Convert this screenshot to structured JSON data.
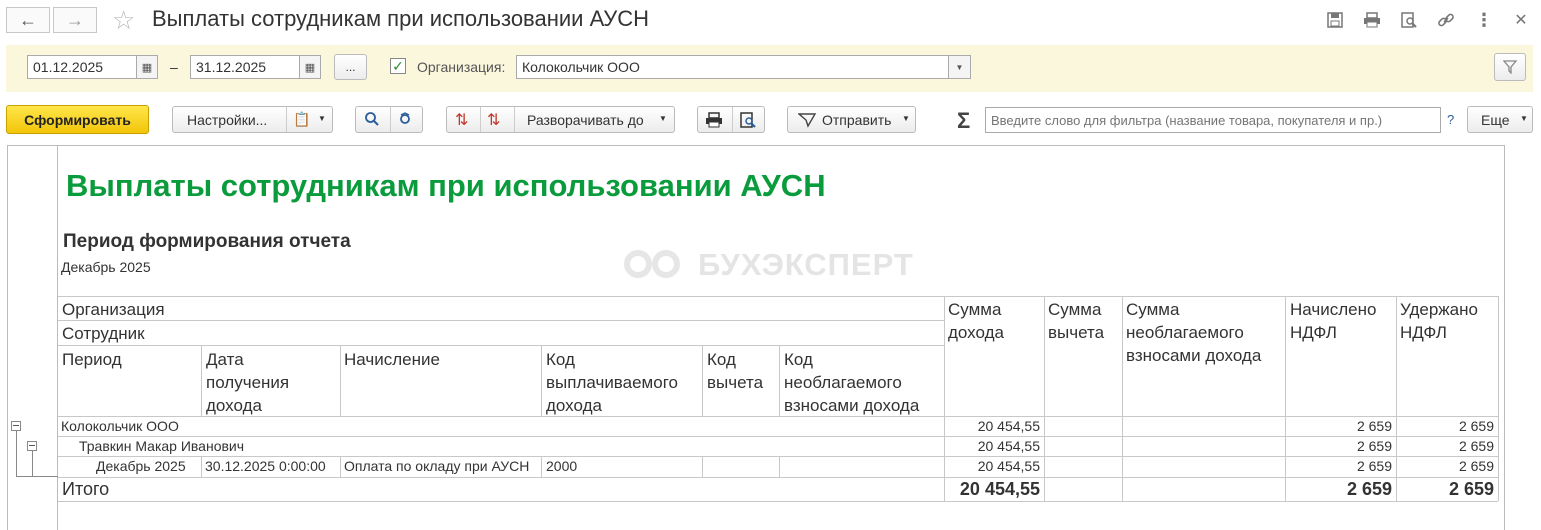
{
  "window": {
    "title": "Выплаты сотрудникам при использовании АУСН"
  },
  "filters": {
    "date_from": "01.12.2025",
    "date_sep": "–",
    "date_to": "31.12.2025",
    "more_label": "...",
    "org_checked": true,
    "org_label": "Организация:",
    "org_value": "Колокольчик ООО"
  },
  "toolbar": {
    "generate_label": "Сформировать",
    "settings_label": "Настройки...",
    "expand_label": "Разворачивать до",
    "send_label": "Отправить",
    "sigma": "Σ",
    "search_placeholder": "Введите слово для фильтра (название товара, покупателя и пр.)",
    "help": "?",
    "more_label": "Еще"
  },
  "report": {
    "title": "Выплаты сотрудникам при использовании АУСН",
    "period_heading": "Период формирования отчета",
    "period_value": "Декабрь 2025",
    "watermark": "БУХЭКСПЕРТ",
    "headers": {
      "organization": "Организация",
      "employee": "Сотрудник",
      "period": "Период",
      "date_line1": "Дата",
      "date_line2": "получения",
      "date_line3": "дохода",
      "accrual": "Начисление",
      "code_paid_line1": "Код",
      "code_paid_line2": "выплачиваемого",
      "code_paid_line3": "дохода",
      "code_ded_line1": "Код",
      "code_ded_line2": "вычета",
      "code_nontax_line1": "Код",
      "code_nontax_line2": "необлагаемого",
      "code_nontax_line3": "взносами дохода",
      "income_line1": "Сумма",
      "income_line2": "дохода",
      "deduction_line1": "Сумма",
      "deduction_line2": "вычета",
      "nontax_line1": "Сумма",
      "nontax_line2": "необлагаемого",
      "nontax_line3": "взносами дохода",
      "ndfl_acc_line1": "Начислено",
      "ndfl_acc_line2": "НДФЛ",
      "ndfl_wh_line1": "Удержано",
      "ndfl_wh_line2": "НДФЛ"
    },
    "rows": [
      {
        "label": "Колокольчик ООО",
        "date": "",
        "accrual": "",
        "code": "",
        "income": "20 454,55",
        "ndfl_acc": "2 659",
        "ndfl_wh": "2 659"
      },
      {
        "label": "Травкин Макар Иванович",
        "date": "",
        "accrual": "",
        "code": "",
        "income": "20 454,55",
        "ndfl_acc": "2 659",
        "ndfl_wh": "2 659"
      },
      {
        "label": "Декабрь 2025",
        "date": "30.12.2025 0:00:00",
        "accrual": "Оплата по окладу при АУСН",
        "code": "2000",
        "income": "20 454,55",
        "ndfl_acc": "2 659",
        "ndfl_wh": "2 659"
      }
    ],
    "total": {
      "label": "Итого",
      "income": "20 454,55",
      "ndfl_acc": "2 659",
      "ndfl_wh": "2 659"
    }
  }
}
